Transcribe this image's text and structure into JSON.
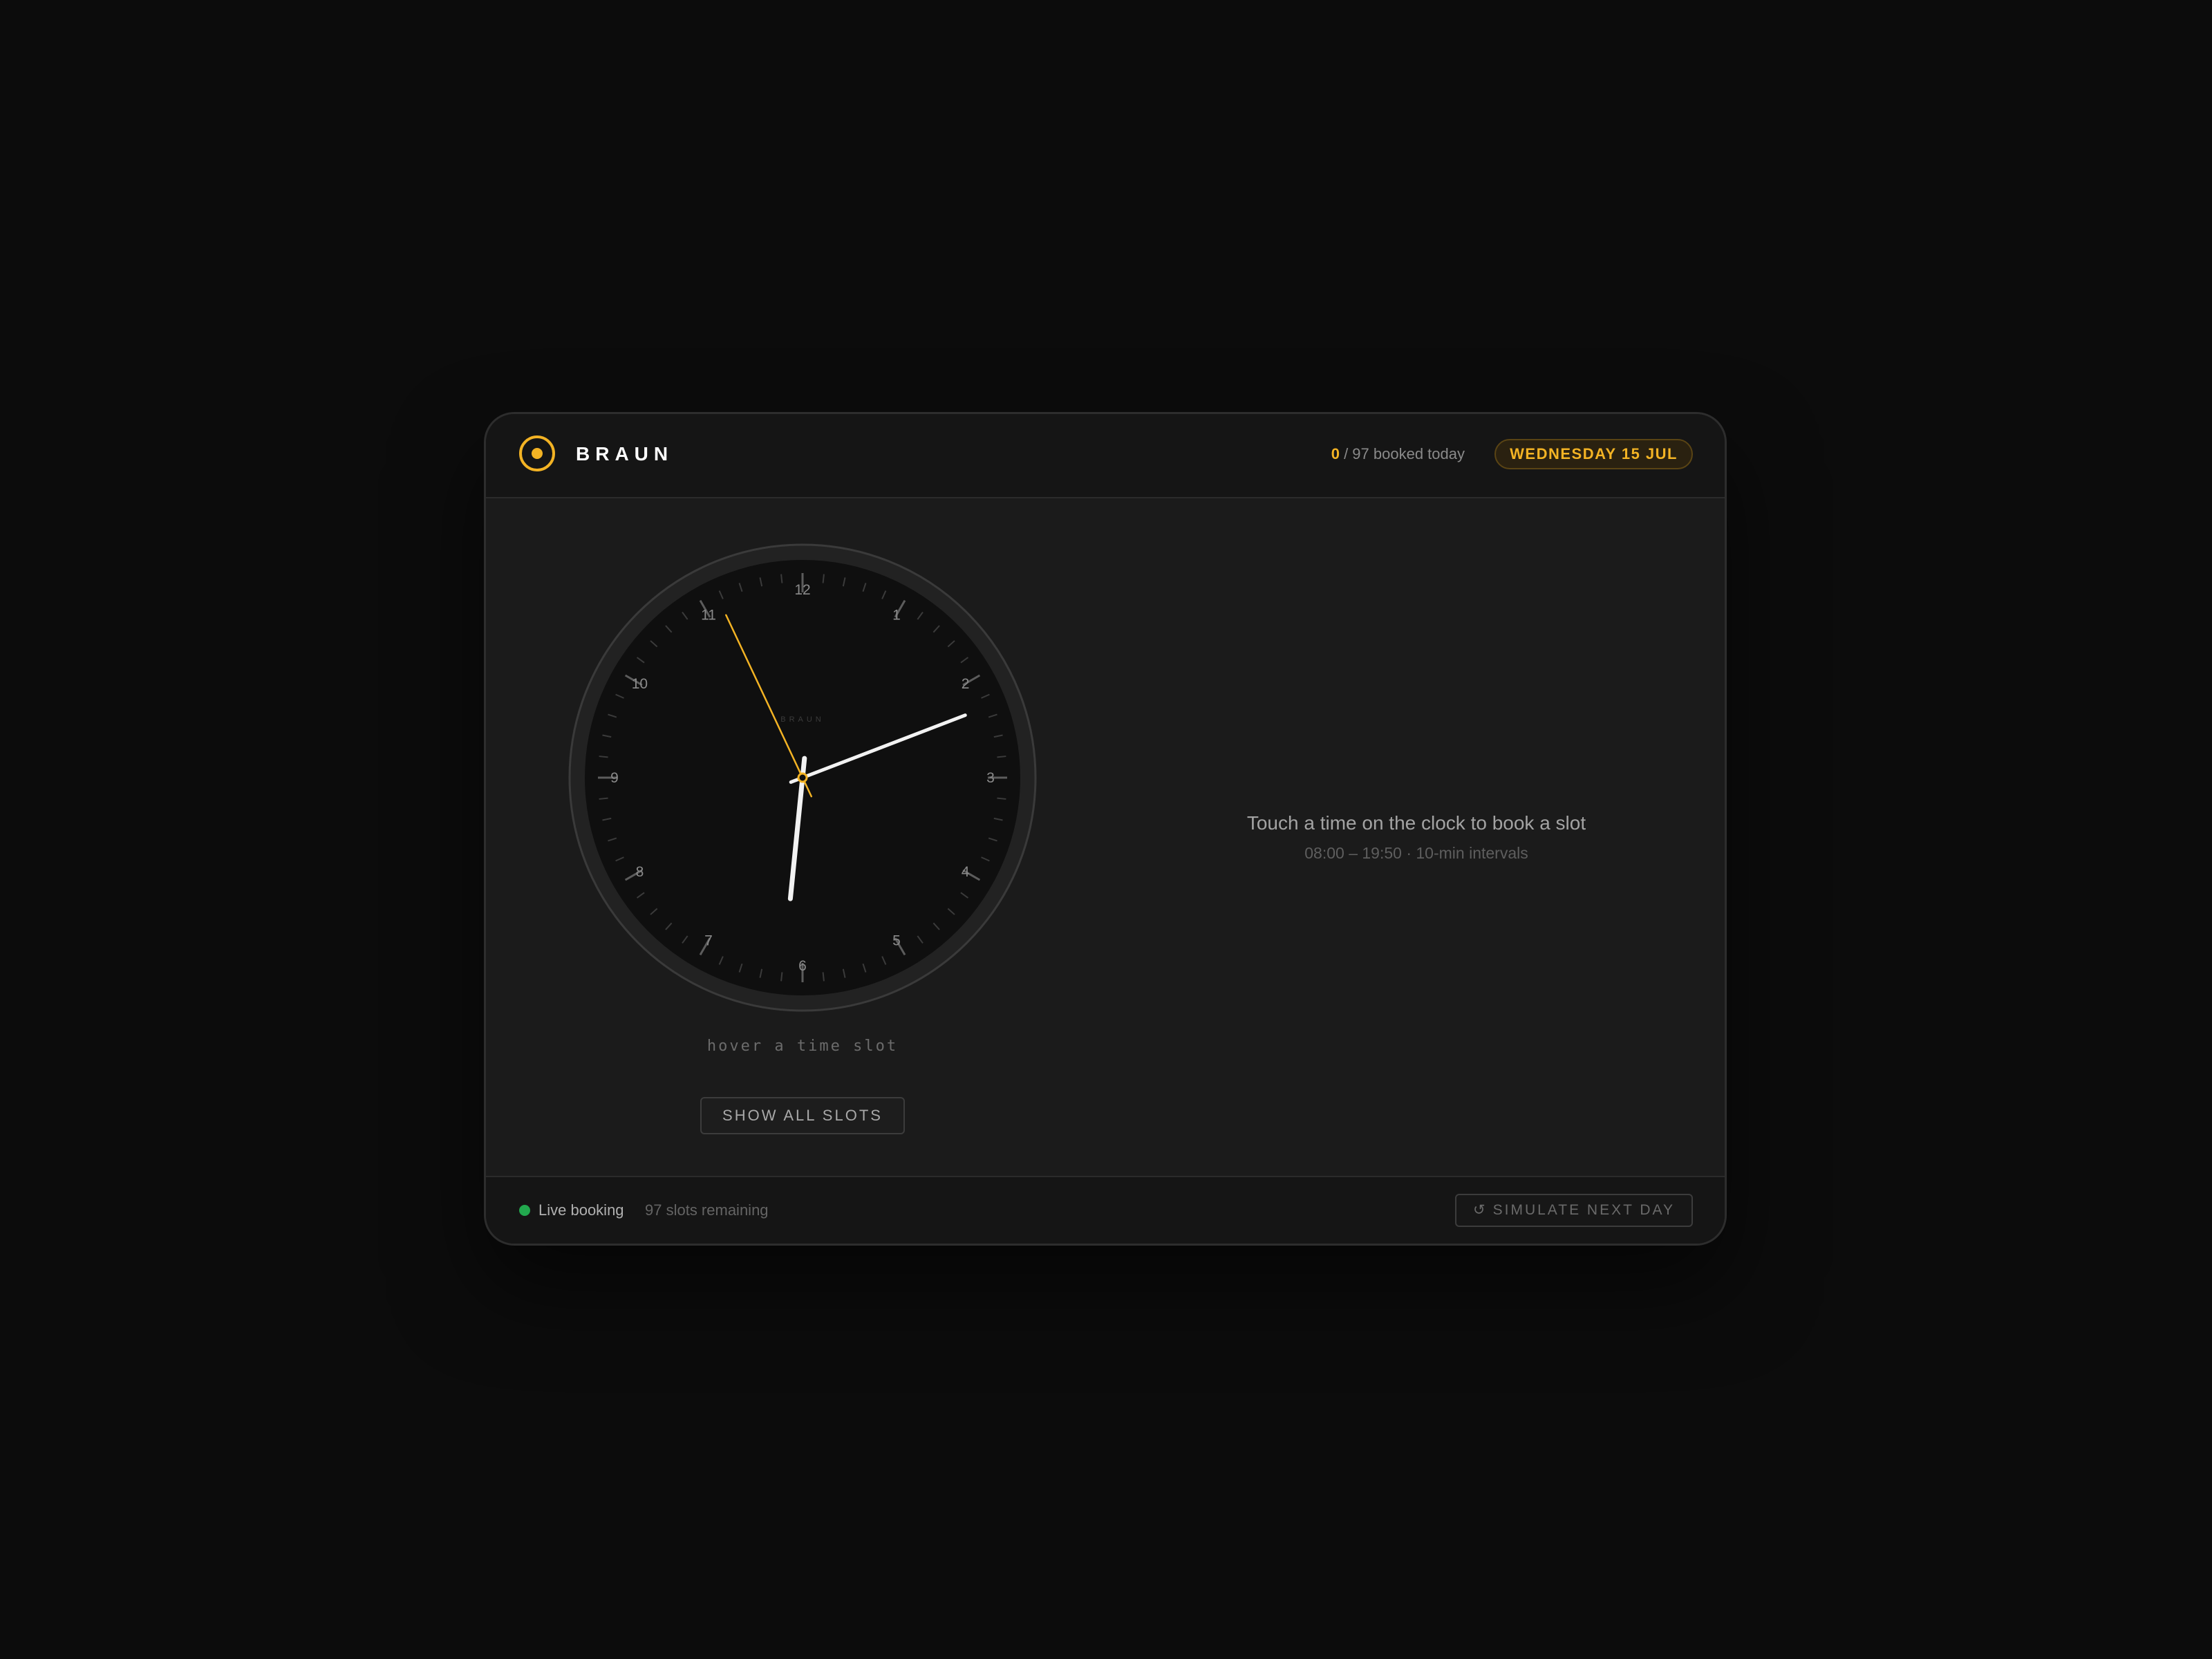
{
  "header": {
    "brand": "BRAUN",
    "booked_num": "0",
    "booked_text": " / 97 booked today",
    "date": "WEDNESDAY 15 JUL"
  },
  "clock": {
    "dial_brand": "BRAUN",
    "numerals": [
      "12",
      "1",
      "2",
      "3",
      "4",
      "5",
      "6",
      "7",
      "8",
      "9",
      "10",
      "11"
    ],
    "time": {
      "hour": 6,
      "minute": 11.5,
      "second": 55.8
    },
    "hover_hint": "hover a time slot",
    "show_all_label": "SHOW ALL SLOTS"
  },
  "prompt": {
    "title": "Touch a time on the clock to book a slot",
    "subtitle": "08:00 – 19:50 · 10-min intervals"
  },
  "footer": {
    "live_label": "Live booking",
    "remaining": "97 slots remaining",
    "simulate_icon": "↺",
    "simulate_label": "SIMULATE NEXT DAY"
  },
  "colors": {
    "accent": "#f3b324",
    "live": "#22a84e",
    "hand": "#f2f2f2"
  },
  "icons": [
    "braun-logo-icon",
    "live-status-icon",
    "reload-icon"
  ]
}
